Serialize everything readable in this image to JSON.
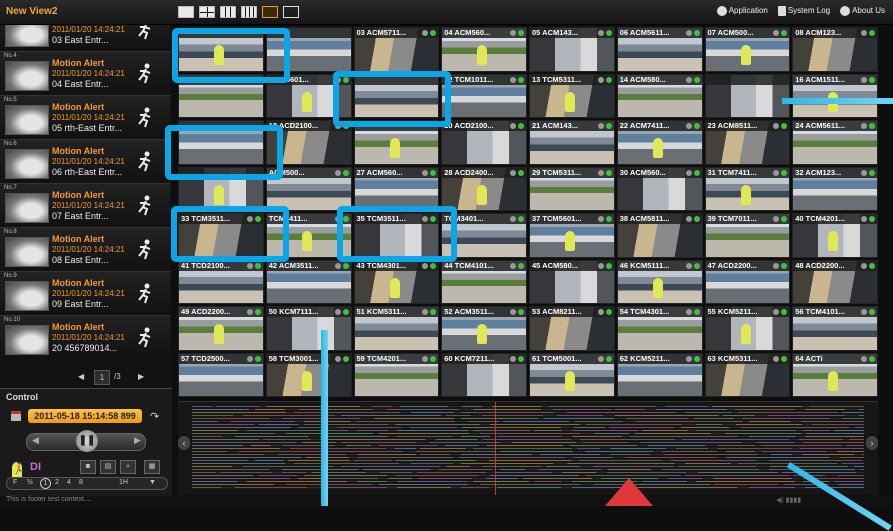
{
  "app": {
    "view_title": "New View2"
  },
  "toolbar": {
    "layouts": [
      "1x1",
      "2x2",
      "3x3",
      "4x4",
      "custom",
      "popout"
    ],
    "selected_layout": "custom",
    "links": [
      {
        "label": "Application",
        "icon": "gear-icon"
      },
      {
        "label": "System Log",
        "icon": "document-icon"
      },
      {
        "label": "About Us",
        "icon": "info-icon"
      }
    ]
  },
  "alerts": [
    {
      "no": "",
      "title": "Motion Alert",
      "time": "2011/01/20 14:24:21",
      "source": "03 East Entr..."
    },
    {
      "no": "No.4",
      "title": "Motion Alert",
      "time": "2011/01/20 14:24:21",
      "source": "04 East Entr..."
    },
    {
      "no": "No.5",
      "title": "Motion Alert",
      "time": "2011/01/20 14:24:21",
      "source": "05 rth-East Entr..."
    },
    {
      "no": "No.6",
      "title": "Motion Alert",
      "time": "2011/01/20 14:24:21",
      "source": "06 rth-East Entr..."
    },
    {
      "no": "No.7",
      "title": "Motion Alert",
      "time": "2011/01/20 14:24:21",
      "source": "07 East Entr..."
    },
    {
      "no": "No.8",
      "title": "Motion Alert",
      "time": "2011/01/20 14:24:21",
      "source": "08 East Entr..."
    },
    {
      "no": "No.9",
      "title": "Motion Alert",
      "time": "2011/01/20 14:24:21",
      "source": "09 East Entr..."
    },
    {
      "no": "No.10",
      "title": "Motion Alert",
      "time": "2011/01/20 14:24:21",
      "source": "20 456789014..."
    }
  ],
  "pager": {
    "current": "1",
    "total": "/3",
    "prev": "◀",
    "next": "▶"
  },
  "control": {
    "label": "Control",
    "datetime": "2011-05-18 15:14:58 899",
    "di_label": "DI",
    "speeds": [
      "F",
      "½",
      "1",
      "2",
      "4",
      "8",
      "1H"
    ],
    "current_speed": "1"
  },
  "footer": {
    "text": "This is footer test context....",
    "volume": "◀) ▮▮▮▮"
  },
  "cameras": [
    "",
    "",
    "03 ACM5711...",
    "04 ACM560...",
    "05 ACM143...",
    "06 ACM5611...",
    "07 ACM500...",
    "08 ACM123...",
    "",
    "ACM5601...",
    "",
    "12 TCM1011...",
    "13 TCM5311...",
    "14 ACM580...",
    "",
    "16 ACM1511...",
    "",
    "18 ACD2100...",
    "",
    "20 ACD2100...",
    "21 ACM143...",
    "22 ACM7411...",
    "23 ACM8511...",
    "24 ACM5611...",
    "",
    "ACM500...",
    "27 ACM560...",
    "28 ACD2400...",
    "29 TCM5311...",
    "30 ACM560...",
    "31 TCM7411...",
    "32 ACM123...",
    "33 TCM3511...",
    "TCM7411...",
    "35 TCM3511...",
    "TCM3401...",
    "37 TCM5601...",
    "38 ACM5811...",
    "39 TCM7011...",
    "40 TCM4201...",
    "41 TCD2100...",
    "42 ACM3511...",
    "43 TCM4301...",
    "44 TCM4101...",
    "45 ACM580...",
    "46 KCM5111...",
    "47 ACD2200...",
    "48 ACD2200...",
    "49 ACD2200...",
    "50 KCM7111...",
    "51 KCM5311...",
    "52 ACM3511...",
    "53 ACM8211...",
    "54 TCM4301...",
    "55 KCM5211...",
    "56 TCM4101...",
    "57 TCD2500...",
    "58 TCM3001...",
    "59 TCM4201...",
    "60 KCM7211...",
    "61 TCM5001...",
    "62 KCM5211...",
    "63 KCM5311...",
    "64 ACTi"
  ],
  "timeline": {
    "nav_left": "‹",
    "nav_right": "›"
  },
  "colors": {
    "accent": "#f39a2c",
    "highlight": "#0aa6e8",
    "online": "#3fc13f",
    "playhead": "#c43a2d"
  }
}
